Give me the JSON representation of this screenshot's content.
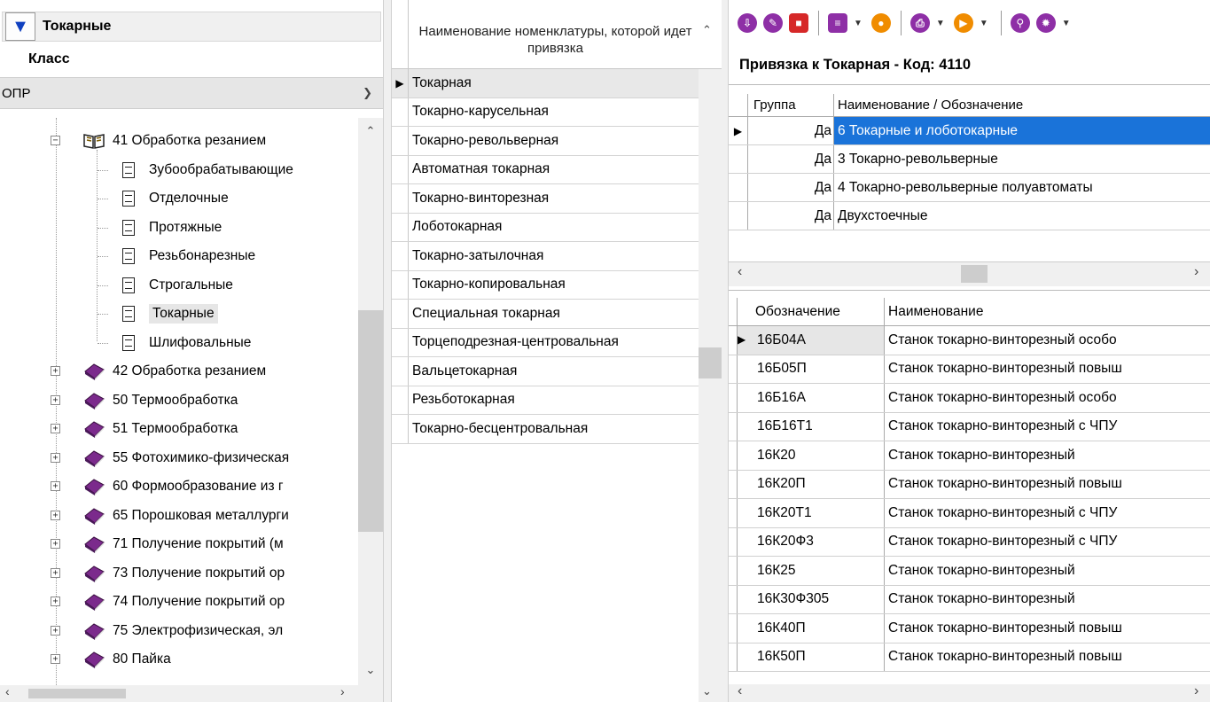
{
  "left": {
    "title": "Токарные",
    "class_label": "Класс",
    "class_value": "ОПР",
    "tree": [
      {
        "label": "41 Обработка резанием",
        "type": "open-book",
        "expanded": true
      },
      {
        "label": "Зубообрабатывающие",
        "type": "doc"
      },
      {
        "label": "Отделочные",
        "type": "doc"
      },
      {
        "label": "Протяжные",
        "type": "doc"
      },
      {
        "label": "Резьбонарезные",
        "type": "doc"
      },
      {
        "label": "Строгальные",
        "type": "doc"
      },
      {
        "label": "Токарные",
        "type": "doc",
        "selected": true
      },
      {
        "label": "Шлифовальные",
        "type": "doc"
      },
      {
        "label": "42 Обработка резанием",
        "type": "book"
      },
      {
        "label": "50 Термообработка",
        "type": "book"
      },
      {
        "label": "51 Термообработка",
        "type": "book"
      },
      {
        "label": "55 Фотохимико-физическая",
        "type": "book"
      },
      {
        "label": "60 Формообразование  из г",
        "type": "book"
      },
      {
        "label": "65 Порошковая металлурги",
        "type": "book"
      },
      {
        "label": "71 Получение покрытий (м",
        "type": "book"
      },
      {
        "label": "73 Получение покрытий ор",
        "type": "book"
      },
      {
        "label": "74 Получение покрытий ор",
        "type": "book"
      },
      {
        "label": "75 Электрофизическая, эл",
        "type": "book"
      },
      {
        "label": "80 Пайка",
        "type": "book"
      }
    ]
  },
  "middle": {
    "header": "Наименование номенклатуры, которой идет привязка",
    "rows": [
      "Токарная",
      "Токарно-карусельная",
      "Токарно-револьверная",
      "Автоматная токарная",
      "Токарно-винторезная",
      "Лоботокарная",
      "Токарно-затылочная",
      "Токарно-копировальная",
      "Специальная токарная",
      "Торцеподрезная-центровальная",
      "Вальцетокарная",
      "Резьботокарная",
      "Токарно-бесцентровальная"
    ]
  },
  "right": {
    "bind_title": "Привязка к Токарная -  Код: 4110",
    "grid1": {
      "col_group": "Группа",
      "col_name": "Наименование / Обозначение",
      "rows": [
        {
          "group": "Да",
          "name": "6 Токарные и лоботокарные"
        },
        {
          "group": "Да",
          "name": "3 Токарно-револьверные"
        },
        {
          "group": "Да",
          "name": "4 Токарно-револьверные полуавтоматы"
        },
        {
          "group": "Да",
          "name": "Двухстоечные"
        }
      ]
    },
    "grid2": {
      "col_code": "Обозначение",
      "col_name": "Наименование",
      "rows": [
        {
          "code": "16Б04А",
          "name": "Станок токарно-винторезный особо"
        },
        {
          "code": "16Б05П",
          "name": "Станок токарно-винторезный повыш"
        },
        {
          "code": "16Б16А",
          "name": "Станок токарно-винторезный особо"
        },
        {
          "code": "16Б16Т1",
          "name": "Станок токарно-винторезный с ЧПУ"
        },
        {
          "code": "16К20",
          "name": "Станок токарно-винторезный"
        },
        {
          "code": "16К20П",
          "name": "Станок токарно-винторезный повыш"
        },
        {
          "code": "16К20Т1",
          "name": "Станок токарно-винторезный с ЧПУ"
        },
        {
          "code": "16К20Ф3",
          "name": "Станок токарно-винторезный с ЧПУ"
        },
        {
          "code": "16К25",
          "name": "Станок токарно-винторезный"
        },
        {
          "code": "16К30Ф305",
          "name": "Станок токарно-винторезный"
        },
        {
          "code": "16К40П",
          "name": "Станок токарно-винторезный повыш"
        },
        {
          "code": "16К50П",
          "name": "Станок токарно-винторезный повыш"
        }
      ]
    }
  },
  "colors": {
    "selection": "#1a73d9",
    "book": "#7b2a8c"
  }
}
